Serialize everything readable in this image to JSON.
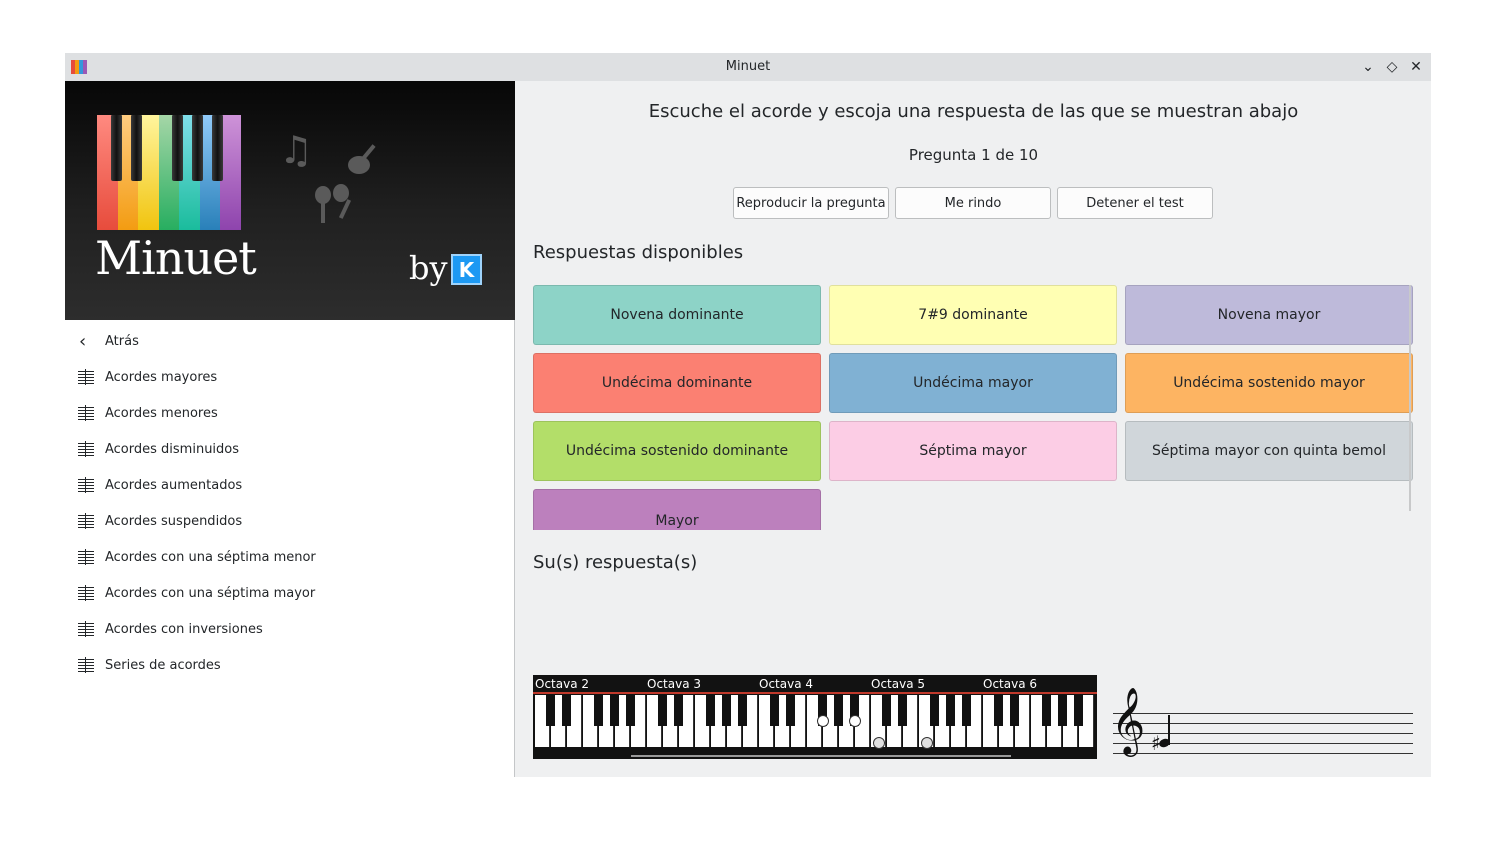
{
  "window": {
    "title": "Minuet",
    "icon_colors": [
      "#e74c3c",
      "#f39c12",
      "#3498db",
      "#9b59b6"
    ],
    "buttons": {
      "minimize": "⌄",
      "maximize": "◇",
      "close": "✕"
    }
  },
  "sidebar": {
    "banner": {
      "title": "Minuet",
      "by": "by",
      "kde_mark": "K"
    },
    "back_label": "Atrás",
    "items": [
      "Acordes mayores",
      "Acordes menores",
      "Acordes disminuidos",
      "Acordes aumentados",
      "Acordes suspendidos",
      "Acordes con una séptima menor",
      "Acordes con una séptima mayor",
      "Acordes con inversiones",
      "Series de acordes"
    ]
  },
  "exercise": {
    "instruction": "Escuche el acorde y escoja una respuesta de las que se muestran abajo",
    "counter": "Pregunta 1 de 10",
    "buttons": {
      "play": "Reproducir la pregunta",
      "give_up": "Me rindo",
      "stop": "Detener el test"
    },
    "available_title": "Respuestas disponibles",
    "answers": [
      {
        "label": "Novena dominante",
        "color": "#8dd3c7"
      },
      {
        "label": "7#9 dominante",
        "color": "#ffffb3"
      },
      {
        "label": "Novena mayor",
        "color": "#bebada"
      },
      {
        "label": "Undécima dominante",
        "color": "#fb8072"
      },
      {
        "label": "Undécima mayor",
        "color": "#80b1d3"
      },
      {
        "label": "Undécima sostenido mayor",
        "color": "#fdb462"
      },
      {
        "label": "Undécima sostenido dominante",
        "color": "#b3de69"
      },
      {
        "label": "Séptima mayor",
        "color": "#fccde5"
      },
      {
        "label": "Séptima mayor con quinta bemol",
        "color": "#d0d6da"
      },
      {
        "label": "Mayor",
        "color": "#bc80bd"
      }
    ],
    "your_answers_title": "Su(s) respuesta(s)"
  },
  "piano": {
    "octave_labels": [
      "Octava 2",
      "Octava 3",
      "Octava 4",
      "Octava 5",
      "Octava 6"
    ],
    "highlight_color": "#c0392b"
  },
  "staff": {
    "clef": "𝄞",
    "accidental": "♯"
  }
}
